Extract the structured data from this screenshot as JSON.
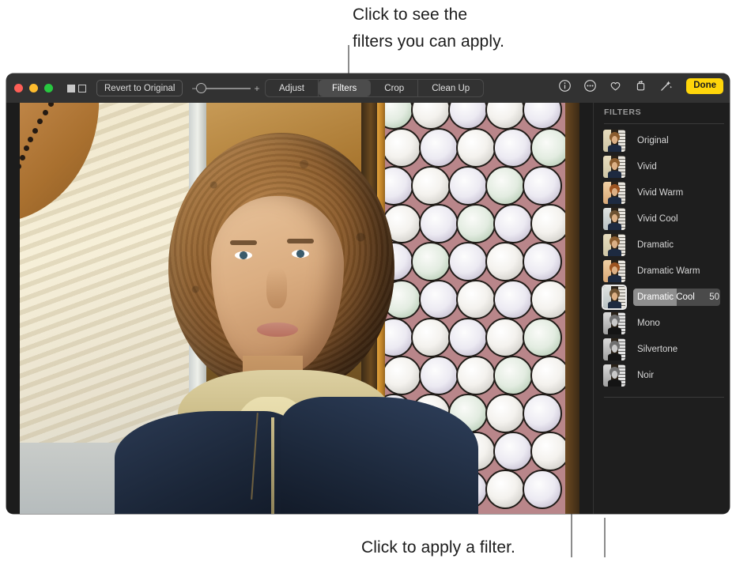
{
  "callouts": {
    "top": "Click to see the\nfilters you can apply.",
    "bottom": "Click to apply a filter."
  },
  "toolbar": {
    "compare_filled_icon": "filled-square-icon",
    "compare_outline_icon": "outline-square-icon",
    "revert_label": "Revert to Original",
    "zoom_out_label": "−",
    "zoom_in_label": "+",
    "segments": [
      {
        "label": "Adjust",
        "active": false
      },
      {
        "label": "Filters",
        "active": true
      },
      {
        "label": "Crop",
        "active": false
      },
      {
        "label": "Clean Up",
        "active": false
      }
    ],
    "right_icons": [
      "info-icon",
      "more-options-icon",
      "favorite-heart-icon",
      "rotate-icon",
      "auto-enhance-wand-icon"
    ],
    "done_label": "Done",
    "done_color": "#ffd60a",
    "traffic_lights": [
      "#ff5f57",
      "#febc2e",
      "#28c840"
    ]
  },
  "sidebar": {
    "title": "FILTERS",
    "filters": [
      {
        "label": "Original",
        "value": "",
        "selected": false,
        "tone": ""
      },
      {
        "label": "Vivid",
        "value": "",
        "selected": false,
        "tone": ""
      },
      {
        "label": "Vivid Warm",
        "value": "",
        "selected": false,
        "tone": "warmish"
      },
      {
        "label": "Vivid Cool",
        "value": "",
        "selected": false,
        "tone": "coolish"
      },
      {
        "label": "Dramatic",
        "value": "",
        "selected": false,
        "tone": ""
      },
      {
        "label": "Dramatic Warm",
        "value": "",
        "selected": false,
        "tone": "warmish"
      },
      {
        "label": "Dramatic Cool",
        "value": "50",
        "selected": true,
        "tone": "coolish"
      },
      {
        "label": "Mono",
        "value": "",
        "selected": false,
        "tone": "mono"
      },
      {
        "label": "Silvertone",
        "value": "",
        "selected": false,
        "tone": "mono"
      },
      {
        "label": "Noir",
        "value": "",
        "selected": false,
        "tone": "mono"
      }
    ]
  }
}
